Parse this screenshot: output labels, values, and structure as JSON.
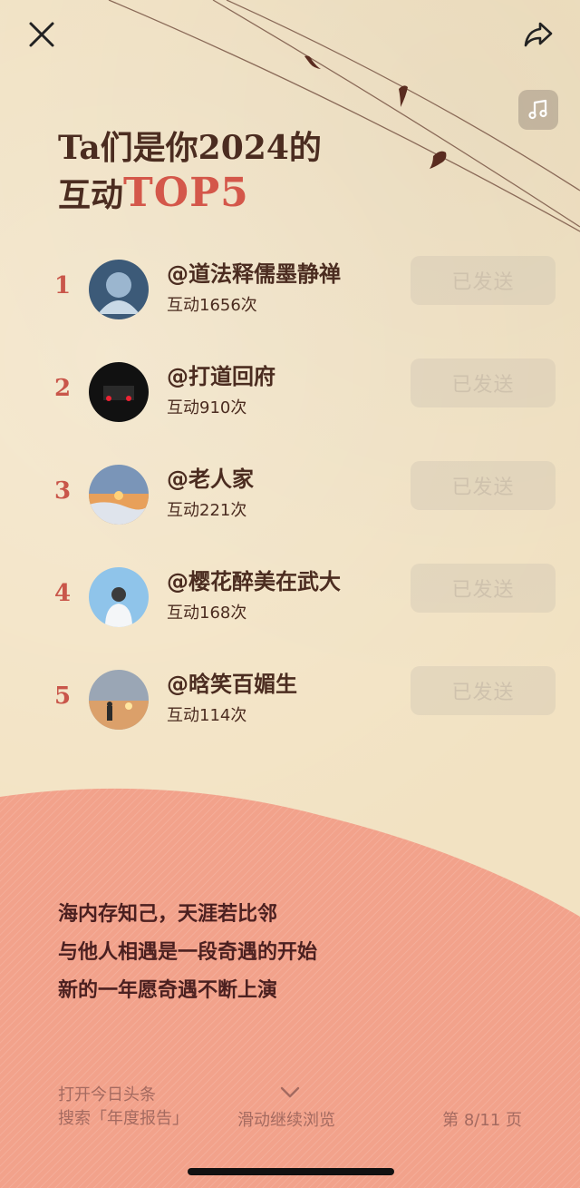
{
  "header": {
    "title_line1": "Ta们是你2024的",
    "title_line2_prefix": "互动",
    "title_line2_accent": "TOP5"
  },
  "icons": {
    "close": "close-icon",
    "share": "share-icon",
    "music": "music-icon"
  },
  "list": [
    {
      "rank": "1",
      "name": "@道法释儒墨静禅",
      "count": "互动1656次",
      "button": "已发送"
    },
    {
      "rank": "2",
      "name": "@打道回府",
      "count": "互动910次",
      "button": "已发送"
    },
    {
      "rank": "3",
      "name": "@老人家",
      "count": "互动221次",
      "button": "已发送"
    },
    {
      "rank": "4",
      "name": "@樱花醉美在武大",
      "count": "互动168次",
      "button": "已发送"
    },
    {
      "rank": "5",
      "name": "@晗笑百媚生",
      "count": "互动114次",
      "button": "已发送"
    }
  ],
  "quote": {
    "line1": "海内存知己，天涯若比邻",
    "line2": "与他人相遇是一段奇遇的开始",
    "line3": "新的一年愿奇遇不断上演"
  },
  "footer": {
    "left_line1": "打开今日头条",
    "left_line2": "搜索「年度报告」",
    "center": "滑动继续浏览",
    "page": "第 8/11 页"
  },
  "colors": {
    "accent": "#d4574a",
    "text_dark": "#4b2c20",
    "background": "#f2e2c2",
    "wave": "#f1a08a"
  }
}
